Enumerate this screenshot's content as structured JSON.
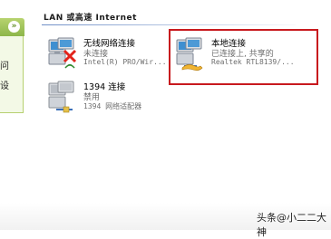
{
  "group": {
    "title": "LAN 或高速 Internet"
  },
  "sidebar": {
    "collapse_glyph": "»",
    "items": [
      {
        "label": "问"
      },
      {
        "label": "设"
      }
    ]
  },
  "connections": [
    {
      "name": "无线网络连接",
      "status": "未连接",
      "device": "Intel(R) PRO/Wir...",
      "icon": "wireless-network-icon",
      "overlay": "red-x"
    },
    {
      "name": "本地连接",
      "status": "已连接上, 共享的",
      "device": "Realtek RTL8139/...",
      "icon": "lan-connection-icon",
      "overlay": "shared-hand"
    },
    {
      "name": "1394 连接",
      "status": "禁用",
      "device": "1394 网络适配器",
      "icon": "1394-connection-icon",
      "overlay": "none"
    }
  ],
  "watermark": {
    "text": "头条@小二二大神"
  },
  "colors": {
    "highlight": "#c8191e",
    "sidebar_header": "#8db64a",
    "status_text": "#6e6e6e"
  }
}
